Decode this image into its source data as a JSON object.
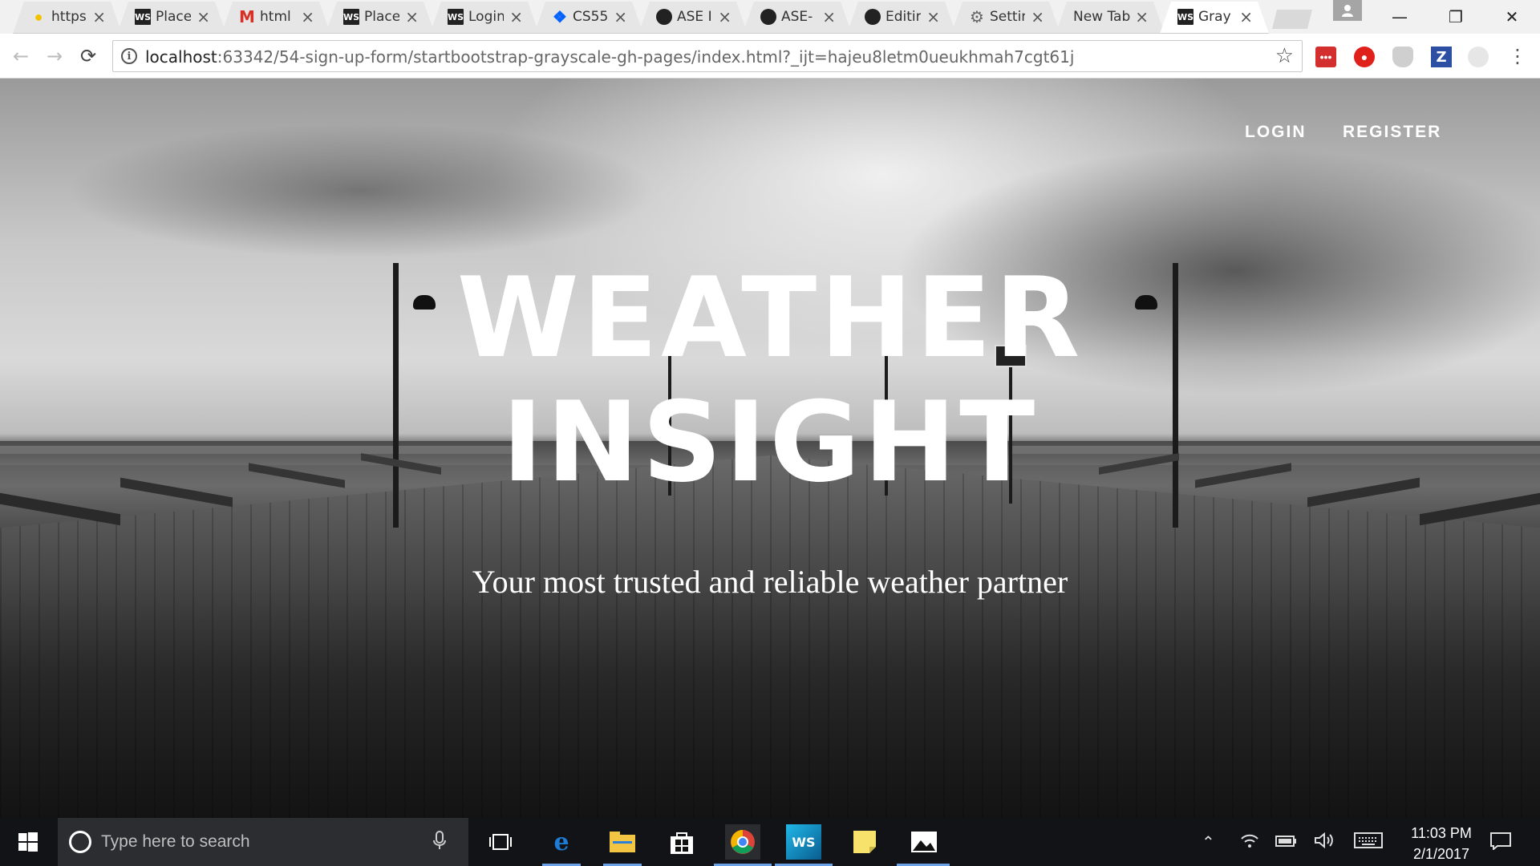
{
  "browser": {
    "tabs": [
      {
        "title": "https",
        "icon": "bulb-icon"
      },
      {
        "title": "Place",
        "icon": "webstorm-icon"
      },
      {
        "title": "html",
        "icon": "gmail-icon"
      },
      {
        "title": "Place",
        "icon": "webstorm-icon"
      },
      {
        "title": "Login",
        "icon": "webstorm-icon"
      },
      {
        "title": "CS55",
        "icon": "dropbox-icon"
      },
      {
        "title": "ASE I",
        "icon": "github-icon"
      },
      {
        "title": "ASE-",
        "icon": "github-icon"
      },
      {
        "title": "Editin",
        "icon": "github-icon"
      },
      {
        "title": "Settin",
        "icon": "gear-icon"
      },
      {
        "title": "New Tab",
        "icon": ""
      },
      {
        "title": "Gray",
        "icon": "webstorm-icon",
        "active": true
      }
    ],
    "url_host": "localhost",
    "url_rest": ":63342/54-sign-up-form/startbootstrap-grayscale-gh-pages/index.html?_ijt=hajeu8letm0ueukhmah7cgt61j"
  },
  "page": {
    "nav": {
      "login": "LOGIN",
      "register": "REGISTER"
    },
    "brand_line1": "WEATHER",
    "brand_line2": "INSIGHT",
    "tagline": "Your most trusted and reliable weather partner"
  },
  "taskbar": {
    "search_placeholder": "Type here to search",
    "time": "11:03 PM",
    "date": "2/1/2017"
  }
}
